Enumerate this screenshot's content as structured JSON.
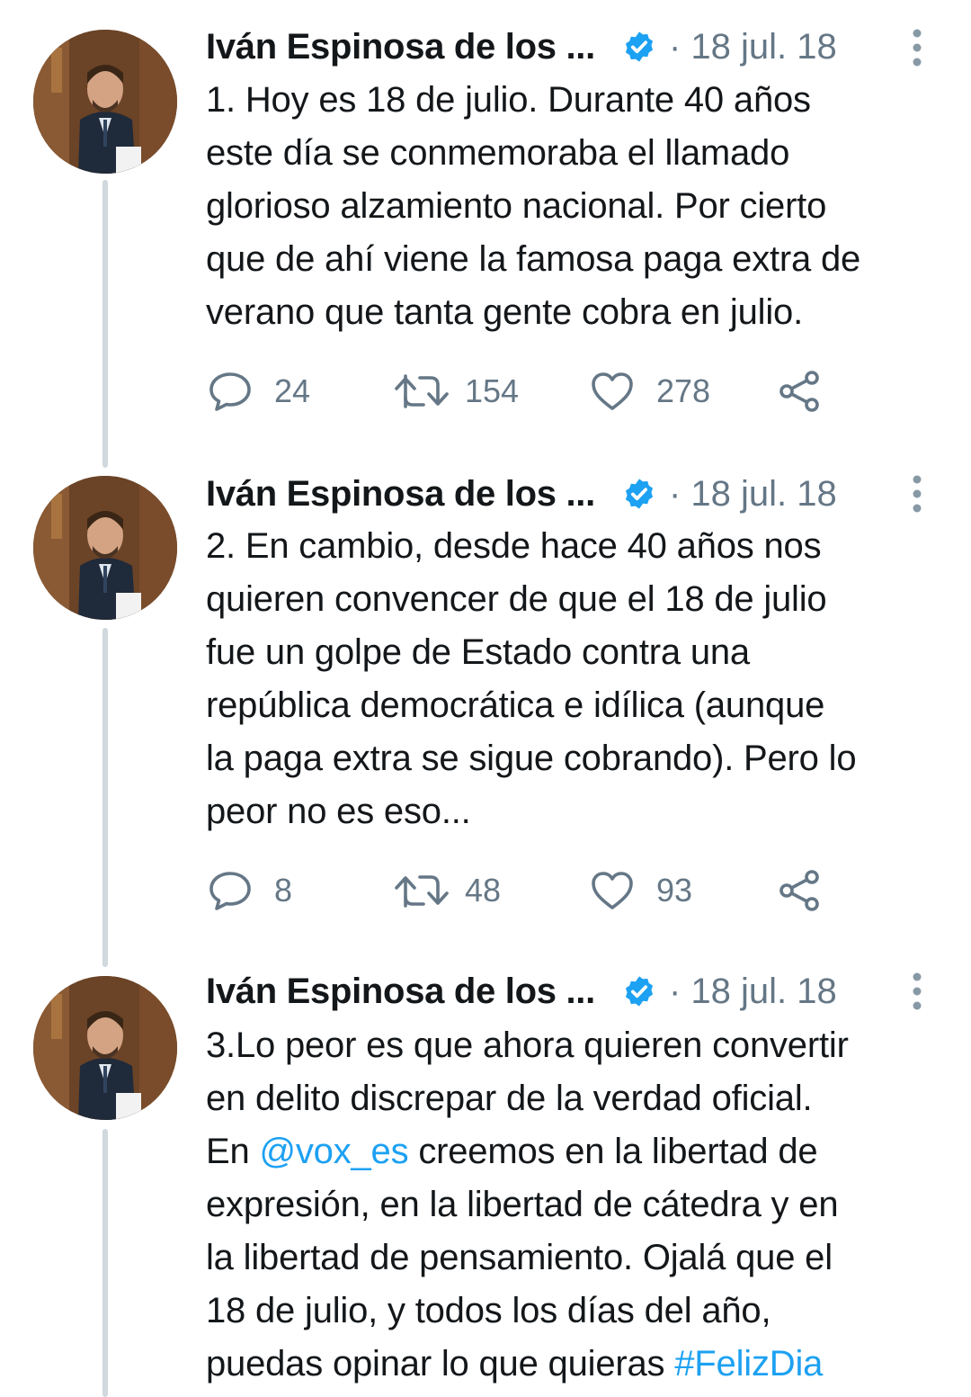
{
  "colors": {
    "text": "#14171a",
    "secondary": "#657786",
    "link": "#1da1f2",
    "verified": "#1da1f2",
    "thread_line": "#cfd9de"
  },
  "tweets": [
    {
      "author": "Iván Espinosa de los ...",
      "date": "· 18 jul. 18",
      "lines": [
        "1. Hoy es 18 de julio. Durante 40 años",
        "este día se conmemoraba el llamado",
        "glorioso alzamiento nacional. Por cierto",
        "que de ahí viene la famosa paga extra de",
        "verano que tanta gente cobra en julio."
      ],
      "replies": "24",
      "retweets": "154",
      "likes": "278"
    },
    {
      "author": "Iván Espinosa de los ...",
      "date": "· 18 jul. 18",
      "lines": [
        "2. En cambio, desde hace 40 años nos",
        "quieren convencer de que el 18 de julio",
        "fue un golpe de Estado contra una",
        "república democrática e idílica (aunque",
        "la paga extra se sigue cobrando). Pero lo",
        "peor no es eso..."
      ],
      "replies": "8",
      "retweets": "48",
      "likes": "93"
    },
    {
      "author": "Iván Espinosa de los ...",
      "date": "· 18 jul. 18",
      "lines": [
        "3.Lo peor es que ahora quieren convertir",
        "en delito discrepar de la verdad oficial."
      ],
      "line3_before": "En ",
      "mention": "@vox_es",
      "line3_after": " creemos en la libertad de",
      "lines_rest": [
        "expresión, en la libertad de cátedra y en",
        "la libertad de pensamiento. Ojalá que el",
        "18 de julio, y todos los días del año,"
      ],
      "last_line_before": "puedas opinar lo que quieras ",
      "hashtag": "#FelizDia"
    }
  ]
}
